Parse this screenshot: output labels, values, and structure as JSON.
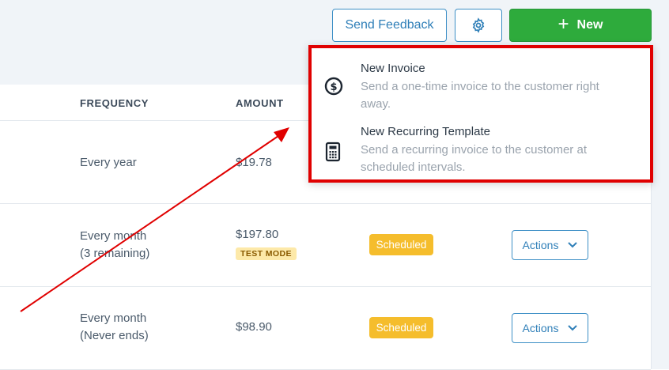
{
  "header": {
    "feedback_label": "Send Feedback",
    "gear_icon": "gear-icon",
    "new_label": "New",
    "new_icon": "plus-icon"
  },
  "table": {
    "columns": {
      "frequency": "FREQUENCY",
      "amount": "AMOUNT"
    },
    "rows": [
      {
        "frequency_line1": "Every year",
        "frequency_line2": "",
        "amount": "$19.78",
        "badge": "",
        "status": "",
        "actions": ""
      },
      {
        "frequency_line1": "Every month",
        "frequency_line2": "(3 remaining)",
        "amount": "$197.80",
        "badge": "TEST MODE",
        "status": "Scheduled",
        "actions": "Actions"
      },
      {
        "frequency_line1": "Every month",
        "frequency_line2": "(Never ends)",
        "amount": "$98.90",
        "badge": "",
        "status": "Scheduled",
        "actions": "Actions"
      }
    ]
  },
  "dropdown": {
    "items": [
      {
        "icon": "dollar-coin-icon",
        "title": "New Invoice",
        "desc": "Send a one-time invoice to the customer right away."
      },
      {
        "icon": "calculator-icon",
        "title": "New Recurring Template",
        "desc": "Send a recurring invoice to the customer at scheduled intervals."
      }
    ]
  },
  "colors": {
    "accent": "#2f7fb8",
    "new_button": "#2eab3c",
    "scheduled": "#f5bd2c",
    "annotation": "#e00000"
  }
}
